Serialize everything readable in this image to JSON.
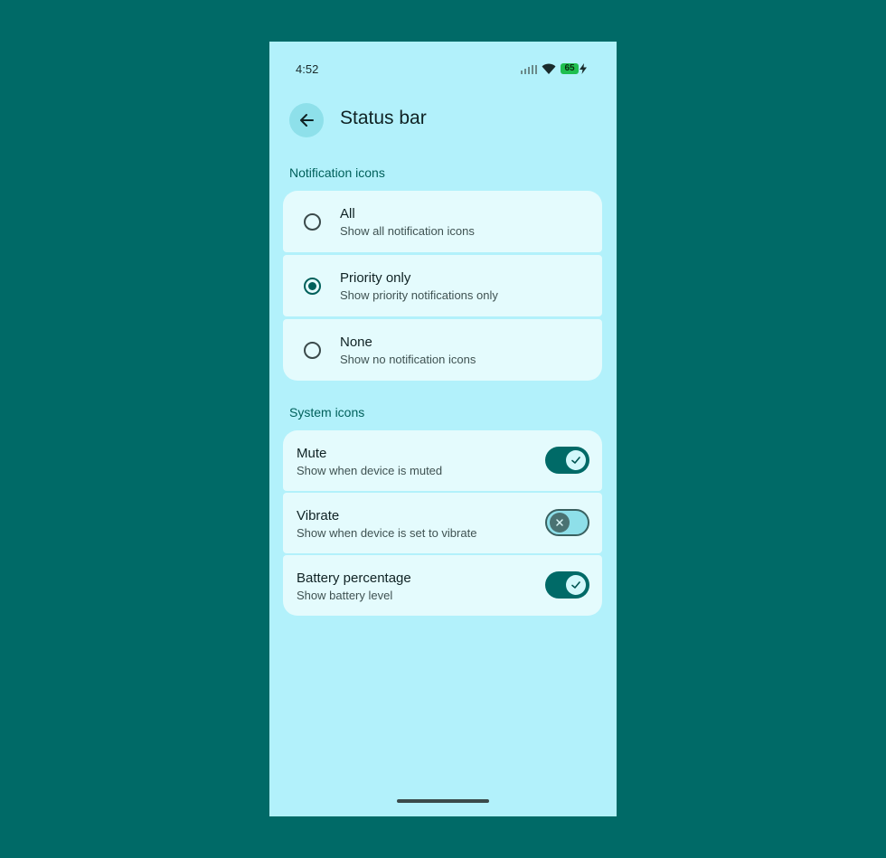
{
  "status_bar": {
    "time": "4:52",
    "battery": "65"
  },
  "header": {
    "title": "Status bar",
    "back_icon": "arrow-back-icon"
  },
  "notification_section": {
    "label": "Notification icons",
    "options": [
      {
        "title": "All",
        "subtitle": "Show all notification icons",
        "selected": false
      },
      {
        "title": "Priority only",
        "subtitle": "Show priority notifications only",
        "selected": true
      },
      {
        "title": "None",
        "subtitle": "Show no notification icons",
        "selected": false
      }
    ]
  },
  "system_section": {
    "label": "System icons",
    "toggles": [
      {
        "title": "Mute",
        "subtitle": "Show when device is muted",
        "on": true
      },
      {
        "title": "Vibrate",
        "subtitle": "Show when device is set to vibrate",
        "on": false
      },
      {
        "title": "Battery percentage",
        "subtitle": "Show battery level",
        "on": true
      }
    ]
  },
  "colors": {
    "background": "#006a67",
    "screen": "#b2f1fb",
    "card": "#e4fbfd",
    "accent": "#00605b"
  }
}
